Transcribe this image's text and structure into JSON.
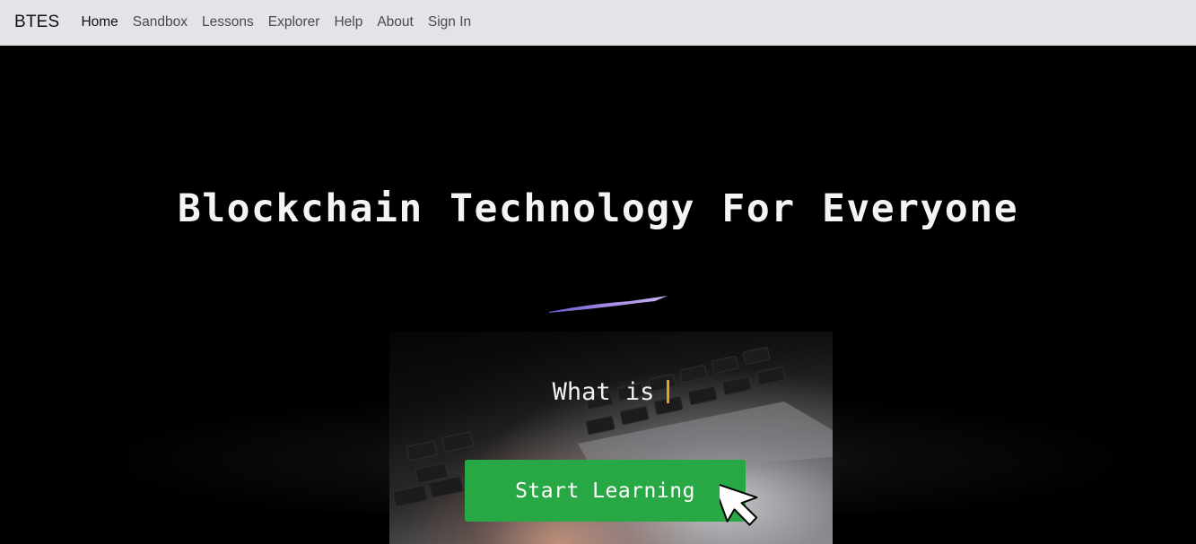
{
  "navbar": {
    "brand": "BTES",
    "links": [
      {
        "label": "Home",
        "active": true
      },
      {
        "label": "Sandbox",
        "active": false
      },
      {
        "label": "Lessons",
        "active": false
      },
      {
        "label": "Explorer",
        "active": false
      },
      {
        "label": "Help",
        "active": false
      },
      {
        "label": "About",
        "active": false
      },
      {
        "label": "Sign In",
        "active": false
      }
    ]
  },
  "hero": {
    "title": "Blockchain Technology For Everyone",
    "typing_text": "What is",
    "cta_label": "Start Learning",
    "icons": {
      "pointer": "mouse-pointer-icon",
      "accent": "accent-stroke"
    }
  },
  "colors": {
    "navbar_bg": "#e3e4e8",
    "hero_bg": "#000000",
    "cta_green": "#28a745",
    "caret": "#e2a227",
    "accent_purple": "#a48ae6"
  }
}
